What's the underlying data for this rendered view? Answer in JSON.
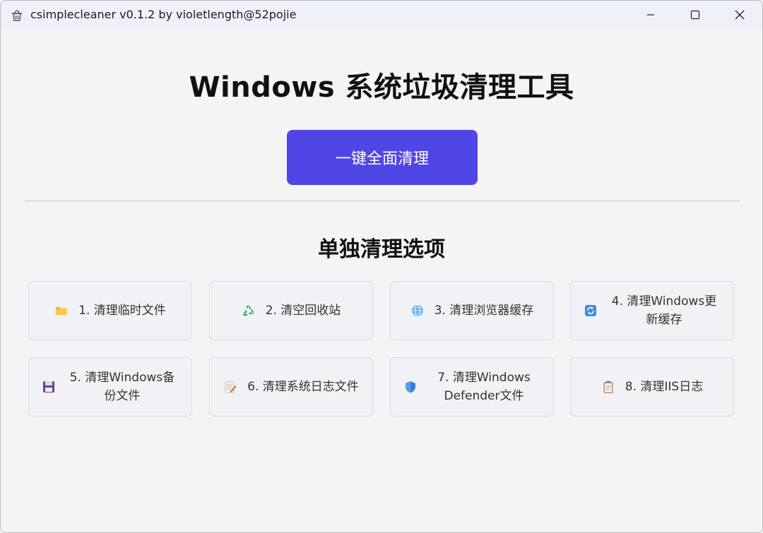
{
  "window": {
    "title": "csimplecleaner v0.1.2 by violetlength@52pojie"
  },
  "main": {
    "title": "Windows 系统垃圾清理工具",
    "oneclick_label": "一键全面清理",
    "section_title": "单独清理选项",
    "accent_color": "#5046e5"
  },
  "options": [
    {
      "label": "1. 清理临时文件",
      "icon": "folder-icon"
    },
    {
      "label": "2. 清空回收站",
      "icon": "recycle-icon"
    },
    {
      "label": "3. 清理浏览器缓存",
      "icon": "globe-icon"
    },
    {
      "label": "4. 清理Windows更新缓存",
      "icon": "update-icon"
    },
    {
      "label": "5. 清理Windows备份文件",
      "icon": "floppy-disk-icon"
    },
    {
      "label": "6. 清理系统日志文件",
      "icon": "memo-icon"
    },
    {
      "label": "7. 清理Windows Defender文件",
      "icon": "shield-icon"
    },
    {
      "label": "8. 清理IIS日志",
      "icon": "clipboard-icon"
    }
  ]
}
